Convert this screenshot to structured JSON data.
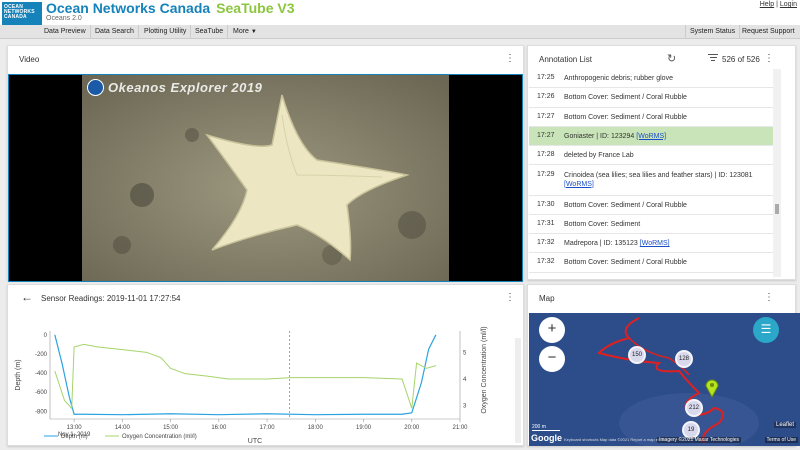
{
  "header": {
    "brand": "Ocean Networks Canada",
    "app_name": "SeaTube V3",
    "version": "Oceans 2.0",
    "logo_text": "OCEAN NETWORKS CANADA",
    "help": "Help",
    "login": "Login",
    "separator": "|"
  },
  "menu": {
    "items": [
      "Data Preview",
      "Data Search",
      "Plotting Utility",
      "SeaTube",
      "More"
    ],
    "right_items": [
      "System Status",
      "Request Support"
    ]
  },
  "video": {
    "title": "Video",
    "watermark": "Okeanos Explorer 2019"
  },
  "annotations": {
    "title": "Annotation List",
    "count": "526 of 526",
    "rows": [
      {
        "time": "17:25",
        "text": "Anthropogenic debris; rubber glove",
        "link": ""
      },
      {
        "time": "17:26",
        "text": "Bottom Cover: Sediment / Coral Rubble",
        "link": ""
      },
      {
        "time": "17:27",
        "text": "Bottom Cover: Sediment / Coral Rubble",
        "link": ""
      },
      {
        "time": "17:27",
        "text": "Goniaster | ID: 123294",
        "link": "[WoRMS]"
      },
      {
        "time": "17:28",
        "text": "deleted by France Lab",
        "link": ""
      },
      {
        "time": "17:29",
        "text": "Crinoidea (sea lilies; sea lilies and feather stars) | ID: 123081",
        "link": "[WoRMS]"
      },
      {
        "time": "17:30",
        "text": "Bottom Cover: Sediment / Coral Rubble",
        "link": ""
      },
      {
        "time": "17:31",
        "text": "Bottom Cover: Sediment",
        "link": ""
      },
      {
        "time": "17:32",
        "text": "Madrepora | ID: 135123",
        "link": "[WoRMS]"
      },
      {
        "time": "17:32",
        "text": "Bottom Cover: Sediment / Coral Rubble",
        "link": ""
      }
    ],
    "selected_index": 3
  },
  "sensor": {
    "title": "Sensor Readings: 2019-11-01 17:27:54",
    "legend": [
      "Depth (m)",
      "Oxygen Concentration (ml/l)"
    ],
    "colors": {
      "depth": "#29a3e0",
      "oxygen": "#a6d46a"
    }
  },
  "map": {
    "title": "Map",
    "clusters": [
      "150",
      "128",
      "212",
      "19"
    ],
    "scale": "200 m",
    "attribution": "Imagery ©2021 Maxar Technologies",
    "terms": "Terms of Use",
    "leaflet": "Leaflet",
    "google": "Google",
    "keyboard": "Keyboard shortcuts",
    "map_data": "Map data ©2021",
    "report": "Report a map error"
  },
  "chart_data": {
    "type": "line",
    "title": "",
    "xlabel": "UTC",
    "x_ticks": [
      "13:00",
      "14:00",
      "15:00",
      "16:00",
      "17:00",
      "18:00",
      "19:00",
      "20:00",
      "21:00"
    ],
    "x_sub": "Nov 1, 2019",
    "ylabel_left": "Depth (m)",
    "ylabel_right": "Oxygen Concentration (ml/l)",
    "yticks_left": [
      "0",
      "-200",
      "-400",
      "-600",
      "-800"
    ],
    "yticks_right": [
      "3",
      "4",
      "5"
    ],
    "ylim_left": [
      -880,
      40
    ],
    "ylim_right": [
      2.5,
      5.8
    ],
    "xlim_hours": [
      12.5,
      21.0
    ],
    "cursor_hours": 17.47,
    "series": [
      {
        "name": "Depth (m)",
        "axis": "left",
        "x": [
          12.6,
          12.75,
          12.9,
          13.0,
          13.2,
          14.0,
          15.0,
          16.0,
          17.0,
          18.0,
          19.0,
          19.8,
          20.0,
          20.2,
          20.35,
          20.5
        ],
        "y": [
          0,
          -300,
          -650,
          -830,
          -830,
          -835,
          -825,
          -835,
          -825,
          -835,
          -830,
          -830,
          -815,
          -500,
          -150,
          0
        ]
      },
      {
        "name": "Oxygen Concentration (ml/l)",
        "axis": "right",
        "x": [
          12.6,
          12.8,
          12.95,
          13.0,
          13.2,
          13.5,
          14.0,
          14.5,
          14.8,
          15.0,
          15.3,
          15.8,
          16.2,
          17.0,
          17.5,
          18.0,
          19.0,
          19.8,
          20.0,
          20.1,
          20.3,
          20.5
        ],
        "y": [
          4.3,
          3.2,
          2.9,
          5.2,
          5.3,
          5.2,
          5.1,
          5.0,
          4.8,
          4.4,
          4.2,
          4.1,
          4.0,
          4.0,
          4.05,
          4.05,
          4.05,
          4.0,
          2.9,
          4.6,
          4.4,
          4.5
        ]
      }
    ]
  }
}
